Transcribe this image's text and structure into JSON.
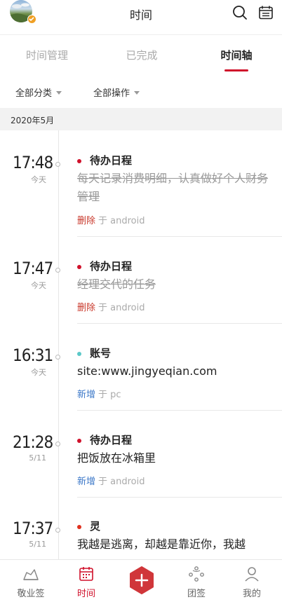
{
  "header": {
    "title": "时间",
    "avatar_icon": "user-avatar",
    "accent": "#d0112b"
  },
  "tabs": [
    {
      "label": "时间管理",
      "active": false
    },
    {
      "label": "已完成",
      "active": false
    },
    {
      "label": "时间轴",
      "active": true
    }
  ],
  "filters": {
    "category": "全部分类",
    "operation": "全部操作"
  },
  "month": "2020年5月",
  "entries": [
    {
      "time": "17:48",
      "date": "今天",
      "category": "待办日程",
      "category_color": "#d0112b",
      "content": "每天记录消费明细，认真做好个人财务管理",
      "struck": true,
      "action": "删除",
      "action_color": "#c9392c",
      "via": "于 android"
    },
    {
      "time": "17:47",
      "date": "今天",
      "category": "待办日程",
      "category_color": "#d0112b",
      "content": "经理交代的任务",
      "struck": true,
      "action": "删除",
      "action_color": "#c9392c",
      "via": "于 android"
    },
    {
      "time": "16:31",
      "date": "今天",
      "category": "账号",
      "category_color": "#5bc8c8",
      "content": "site:www.jingyeqian.com",
      "struck": false,
      "action": "新增",
      "action_color": "#3c78c8",
      "via": "于 pc"
    },
    {
      "time": "21:28",
      "date": "5/11",
      "category": "待办日程",
      "category_color": "#d0112b",
      "content": "把饭放在冰箱里",
      "struck": false,
      "action": "新增",
      "action_color": "#3c78c8",
      "via": "于 android"
    },
    {
      "time": "17:37",
      "date": "5/11",
      "category": "灵",
      "category_color": "#e0301e",
      "content": "我越是逃离，却越是靠近你，我越",
      "struck": false,
      "action": "",
      "action_color": "#3c78c8",
      "via": ""
    }
  ],
  "bottom_nav": [
    {
      "label": "敬业签",
      "icon": "jingyeqian-icon",
      "active": false
    },
    {
      "label": "时间",
      "icon": "calendar-icon",
      "active": true
    },
    {
      "label": "",
      "icon": "add-icon",
      "active": false
    },
    {
      "label": "团签",
      "icon": "team-icon",
      "active": false
    },
    {
      "label": "我的",
      "icon": "profile-icon",
      "active": false
    }
  ]
}
